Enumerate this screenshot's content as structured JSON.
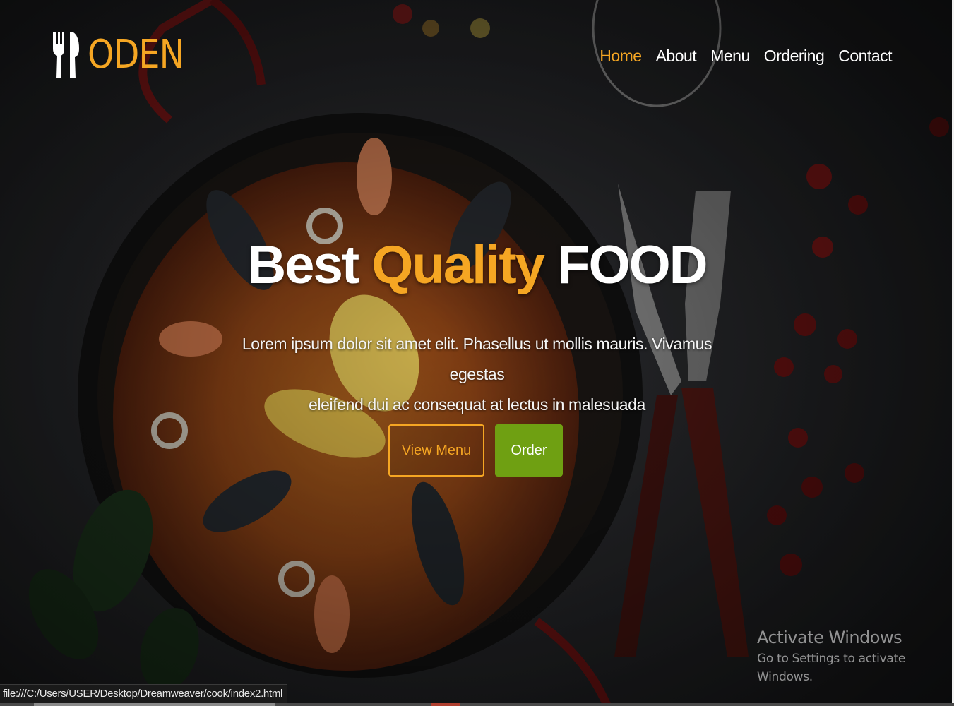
{
  "brand": {
    "name": "ODEN",
    "accent_color": "#f5a623",
    "icon": "fork-spoon-icon"
  },
  "nav": {
    "items": [
      {
        "label": "Home",
        "active": true
      },
      {
        "label": "About",
        "active": false
      },
      {
        "label": "Menu",
        "active": false
      },
      {
        "label": "Ordering",
        "active": false
      },
      {
        "label": "Contact",
        "active": false
      }
    ]
  },
  "hero": {
    "headline": {
      "part1": "Best",
      "part2": "Quality",
      "part3": "FOOD"
    },
    "lead_line1": "Lorem ipsum dolor sit amet elit. Phasellus ut mollis mauris. Vivamus egestas",
    "lead_line2": "eleifend dui ac consequat at lectus in malesuada",
    "buttons": {
      "view_menu": "View Menu",
      "order": "Order",
      "order_color": "#6fa012"
    },
    "background": "paella-pan-photo"
  },
  "watermark": {
    "title": "Activate Windows",
    "subtitle": "Go to Settings to activate Windows."
  },
  "status_bar": {
    "url": "file:///C:/Users/USER/Desktop/Dreamweaver/cook/index2.html"
  }
}
